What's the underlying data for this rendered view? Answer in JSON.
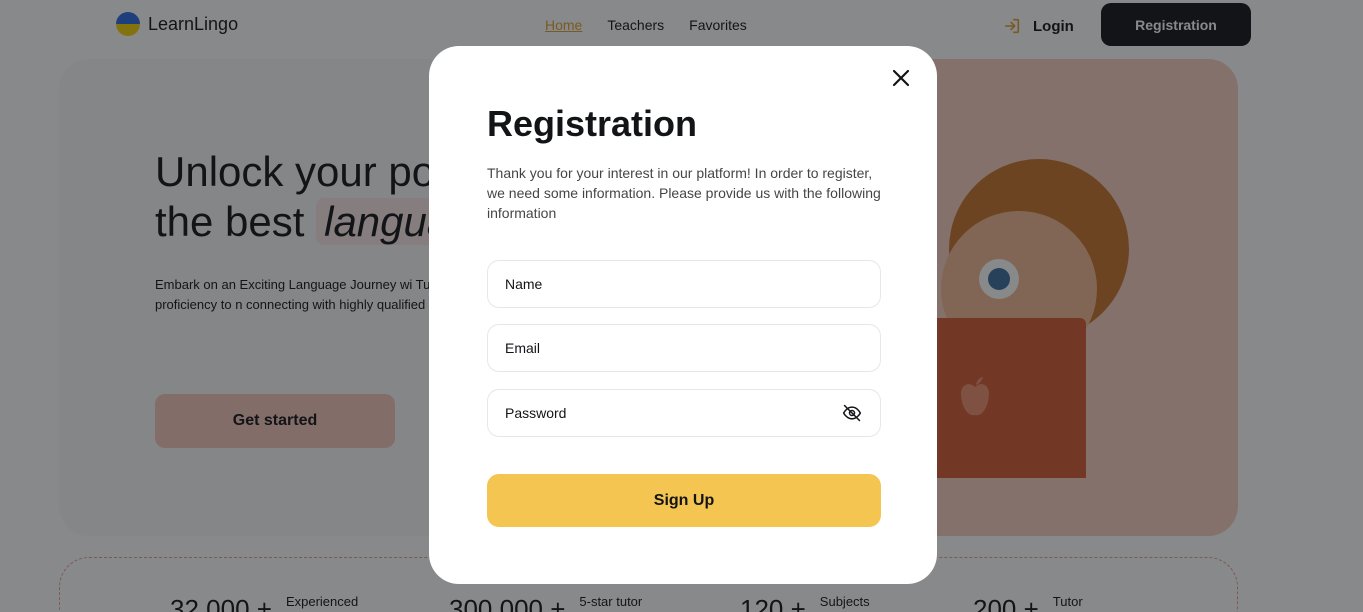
{
  "header": {
    "logo_text": "LearnLingo",
    "nav": [
      "Home",
      "Teachers",
      "Favorites"
    ],
    "login_label": "Login",
    "registration_label": "Registration"
  },
  "hero": {
    "title_line1": "Unlock your po",
    "title_line2_prefix": "the best ",
    "title_highlight": "langua",
    "text": "Embark on an Exciting Language Journey wi Tutors: Elevate your language proficiency to n connecting with highly qualified and experienc",
    "cta_label": "Get started"
  },
  "stats": [
    {
      "num": "32,000 +",
      "label": "Experienced"
    },
    {
      "num": "300,000 +",
      "label": "5-star tutor"
    },
    {
      "num": "120 +",
      "label": "Subjects"
    },
    {
      "num": "200 +",
      "label": "Tutor"
    }
  ],
  "modal": {
    "title": "Registration",
    "description": "Thank you for your interest in our platform! In order to register, we need some information. Please provide us with the following information",
    "name_placeholder": "Name",
    "email_placeholder": "Email",
    "password_placeholder": "Password",
    "signup_label": "Sign Up"
  },
  "colors": {
    "accent": "#f4c550",
    "hero_cta": "#f4c7b8",
    "nav_active": "#e0a030",
    "dark": "#121417"
  },
  "icons": {
    "close": "close-icon",
    "eye_off": "eye-off-icon",
    "login": "login-arrow-icon"
  }
}
